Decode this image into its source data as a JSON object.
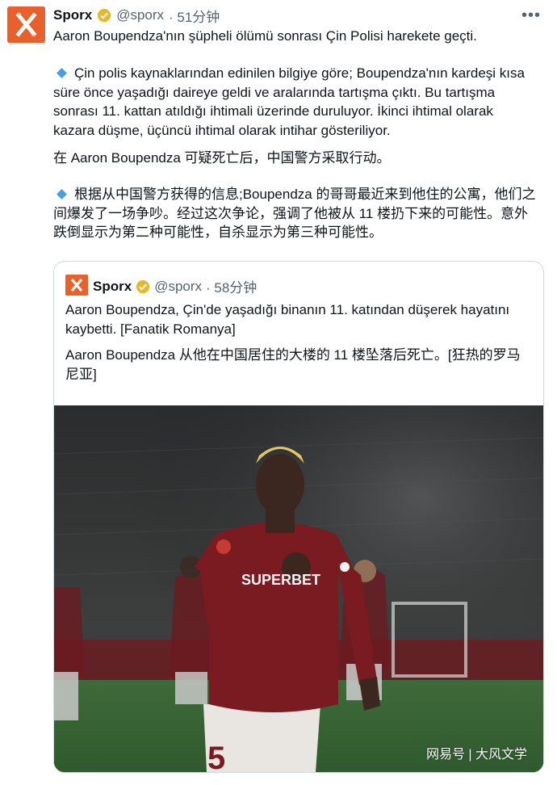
{
  "tweet": {
    "author_name": "Sporx",
    "handle": "@sporx",
    "time": "· 51分钟",
    "more_icon": "more-dots-icon",
    "title": "Aaron Boupendza'nın şüpheli ölümü sonrası Çin Polisi harekete geçti.",
    "paragraph_tr": "Çin polis kaynaklarından edinilen bilgiye göre; Boupendza'nın kardeşi kısa süre önce yaşadığı daireye geldi ve aralarında tartışma çıktı. Bu tartışma sonrası 11. kattan atıldığı ihtimali üzerinde duruluyor. İkinci ihtimal olarak kazara düşme, üçüncü ihtimal olarak intihar gösteriliyor.",
    "title_zh": "在 Aaron Boupendza 可疑死亡后，中国警方采取行动。",
    "paragraph_zh": "根据从中国警方获得的信息;Boupendza 的哥哥最近来到他住的公寓，他们之间爆发了一场争吵。经过这次争论，强调了他被从 11 楼扔下来的可能性。意外跌倒显示为第二种可能性，自杀显示为第三种可能性。"
  },
  "quoted": {
    "author_name": "Sporx",
    "handle": "@sporx",
    "time": "· 58分钟",
    "text_tr": "Aaron Boupendza, Çin'de yaşadığı binanın 11. katından düşerek hayatını kaybetti. [Fanatik Romanya]",
    "text_zh": "Aaron Boupendza 从他在中国居住的大楼的 11 楼坠落后死亡。[狂热的罗马尼亚]"
  },
  "photo": {
    "jersey_sponsor": "SUPERBET",
    "jersey_number": "5",
    "watermark": "网易号 | 大风文学"
  },
  "colors": {
    "brand": "#e8602b",
    "verified_badge": "#e8b82b",
    "jersey": "#7a1b22",
    "link_gray": "#536471"
  }
}
